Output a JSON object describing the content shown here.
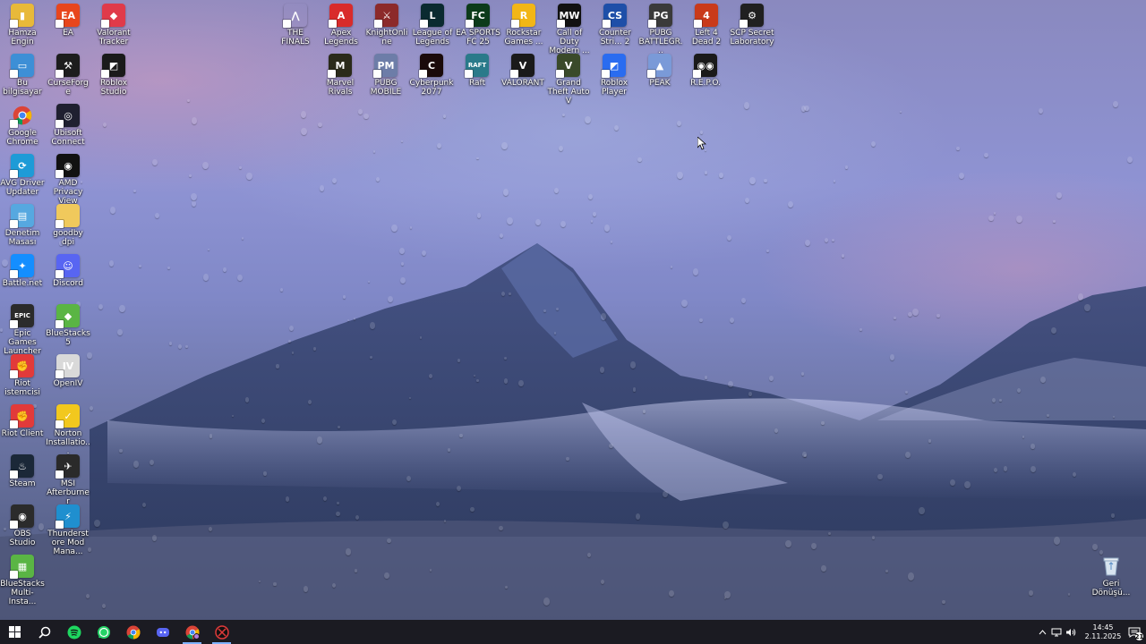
{
  "desktop_icons_left": [
    {
      "label": "Hamza Engin",
      "icon": "user-folder-icon",
      "bg": "#e8b93a",
      "glyph": "▮"
    },
    {
      "label": "EA",
      "icon": "ea-icon",
      "bg": "#e8461d",
      "glyph": "EA"
    },
    {
      "label": "Valorant Tracker",
      "icon": "valorant-tracker-icon",
      "bg": "#e03a4a",
      "glyph": "◆"
    },
    {
      "label": "Bu bilgisayar",
      "icon": "this-pc-icon",
      "bg": "#3d8fd6",
      "glyph": "▭"
    },
    {
      "label": "CurseForge",
      "icon": "curseforge-icon",
      "bg": "#1d1d1d",
      "glyph": "⚒"
    },
    {
      "label": "Roblox Studio",
      "icon": "roblox-studio-icon",
      "bg": "#1a1a1a",
      "glyph": "◩"
    },
    {
      "label": "Google Chrome",
      "icon": "chrome-icon",
      "bg": "#ffffff",
      "glyph": ""
    },
    {
      "label": "Ubisoft Connect",
      "icon": "ubisoft-icon",
      "bg": "#1f2030",
      "glyph": "◎"
    },
    {
      "label": "AVG Driver Updater",
      "icon": "avg-driver-icon",
      "bg": "#1e9bd7",
      "glyph": "⟳"
    },
    {
      "label": "AMD Privacy View",
      "icon": "amd-privacy-icon",
      "bg": "#111111",
      "glyph": "◉"
    },
    {
      "label": "Denetim Masası",
      "icon": "control-panel-icon",
      "bg": "#56a8e0",
      "glyph": "▤"
    },
    {
      "label": "goodby dpi",
      "icon": "folder-icon",
      "bg": "#f0c95c",
      "glyph": ""
    },
    {
      "label": "Battle.net",
      "icon": "battlenet-icon",
      "bg": "#148eff",
      "glyph": "✦"
    },
    {
      "label": "Discord",
      "icon": "discord-icon",
      "bg": "#5865f2",
      "glyph": "☺"
    },
    {
      "label": "Epic Games Launcher",
      "icon": "epic-games-icon",
      "bg": "#2b2b2b",
      "glyph": "EPIC"
    },
    {
      "label": "BlueStacks 5",
      "icon": "bluestacks-icon",
      "bg": "#5ab544",
      "glyph": "◆"
    },
    {
      "label": "Riot istemcisi",
      "icon": "riot-client-icon",
      "bg": "#e23a3a",
      "glyph": "✊"
    },
    {
      "label": "OpenIV",
      "icon": "openiv-icon",
      "bg": "#d9d9d9",
      "glyph": "IV"
    },
    {
      "label": "Riot Client",
      "icon": "riot-client-2-icon",
      "bg": "#e23a3a",
      "glyph": "✊"
    },
    {
      "label": "Norton Installatio...",
      "icon": "norton-icon",
      "bg": "#f2c81e",
      "glyph": "✓"
    },
    {
      "label": "Steam",
      "icon": "steam-icon",
      "bg": "#1b2838",
      "glyph": "♨"
    },
    {
      "label": "MSI Afterburner",
      "icon": "msi-afterburner-icon",
      "bg": "#2a2a2a",
      "glyph": "✈"
    },
    {
      "label": "OBS Studio",
      "icon": "obs-icon",
      "bg": "#2b2b2b",
      "glyph": "◉"
    },
    {
      "label": "Thunderstore Mod Mana...",
      "icon": "thunderstore-icon",
      "bg": "#1f8fcf",
      "glyph": "⚡"
    },
    {
      "label": "BlueStacks Multi-Insta...",
      "icon": "bluestacks-multi-icon",
      "bg": "#5ab544",
      "glyph": "▦"
    }
  ],
  "desktop_icons_top": [
    {
      "label": "THE FINALS",
      "icon": "the-finals-icon",
      "bg": "transparent",
      "glyph": "⋀"
    },
    {
      "label": "Apex Legends",
      "icon": "apex-icon",
      "bg": "#d92b2b",
      "glyph": "A"
    },
    {
      "label": "KnightOnline",
      "icon": "knight-online-icon",
      "bg": "#8c2a2a",
      "glyph": "⚔"
    },
    {
      "label": "League of Legends",
      "icon": "league-icon",
      "bg": "#0a2a30",
      "glyph": "L"
    },
    {
      "label": "EA SPORTS FC 25",
      "icon": "ea-fc-icon",
      "bg": "#0c3b1a",
      "glyph": "FC"
    },
    {
      "label": "Rockstar Games ...",
      "icon": "rockstar-icon",
      "bg": "#f2b616",
      "glyph": "R"
    },
    {
      "label": "Call of Duty Modern ...",
      "icon": "cod-icon",
      "bg": "#111111",
      "glyph": "MW"
    },
    {
      "label": "Counter Stri... 2",
      "icon": "cs2-icon",
      "bg": "#1e4fa8",
      "glyph": "CS"
    },
    {
      "label": "PUBG BATTLEGR...",
      "icon": "pubg-icon",
      "bg": "#3a3a3a",
      "glyph": "PG"
    },
    {
      "label": "Left 4 Dead 2",
      "icon": "l4d2-icon",
      "bg": "#c93a1a",
      "glyph": "4"
    },
    {
      "label": "SCP Secret Laboratory",
      "icon": "scp-icon",
      "bg": "#202020",
      "glyph": "⚙"
    },
    {
      "label": "Marvel Rivals",
      "icon": "marvel-rivals-icon",
      "bg": "#2a2a1a",
      "glyph": "M"
    },
    {
      "label": "PUBG MOBILE",
      "icon": "pubg-mobile-icon",
      "bg": "#6d7da8",
      "glyph": "PM"
    },
    {
      "label": "Cyberpunk 2077",
      "icon": "cyberpunk-icon",
      "bg": "#1a0a0a",
      "glyph": "C"
    },
    {
      "label": "Raft",
      "icon": "raft-icon",
      "bg": "#2a7a8a",
      "glyph": "RAFT"
    },
    {
      "label": "VALORANT",
      "icon": "valorant-icon",
      "bg": "#1a1a1a",
      "glyph": "V"
    },
    {
      "label": "Grand Theft Auto V",
      "icon": "gta5-icon",
      "bg": "#3a4a2a",
      "glyph": "V"
    },
    {
      "label": "Roblox Player",
      "icon": "roblox-player-icon",
      "bg": "#2a6cf0",
      "glyph": "◩"
    },
    {
      "label": "PEAK",
      "icon": "peak-icon",
      "bg": "#7a9ad8",
      "glyph": "▲"
    },
    {
      "label": "R.E.P.O.",
      "icon": "repo-icon",
      "bg": "#1a1a1a",
      "glyph": "◉◉"
    }
  ],
  "recycle_bin": {
    "label": "Geri Dönüşü...",
    "icon": "recycle-bin-icon"
  },
  "taskbar": {
    "apps": [
      {
        "name": "start-button",
        "icon": "windows-icon",
        "color": "#ffffff"
      },
      {
        "name": "search-button",
        "icon": "search-icon",
        "color": "#ffffff"
      },
      {
        "name": "spotify-taskbar",
        "icon": "spotify-icon",
        "color": "#1ed760"
      },
      {
        "name": "whatsapp-taskbar",
        "icon": "whatsapp-icon",
        "color": "#25d366"
      },
      {
        "name": "chrome-taskbar",
        "icon": "chrome-icon",
        "color": "#ffffff"
      },
      {
        "name": "discord-taskbar",
        "icon": "discord-icon",
        "color": "#5865f2"
      },
      {
        "name": "chrome-profile-taskbar",
        "icon": "chrome-profile-icon",
        "color": "#ffffff"
      },
      {
        "name": "recorder-taskbar",
        "icon": "recorder-icon",
        "color": "#e03a3a"
      }
    ],
    "time": "14:45",
    "date": "2.11.2025",
    "notification_count": "21"
  }
}
